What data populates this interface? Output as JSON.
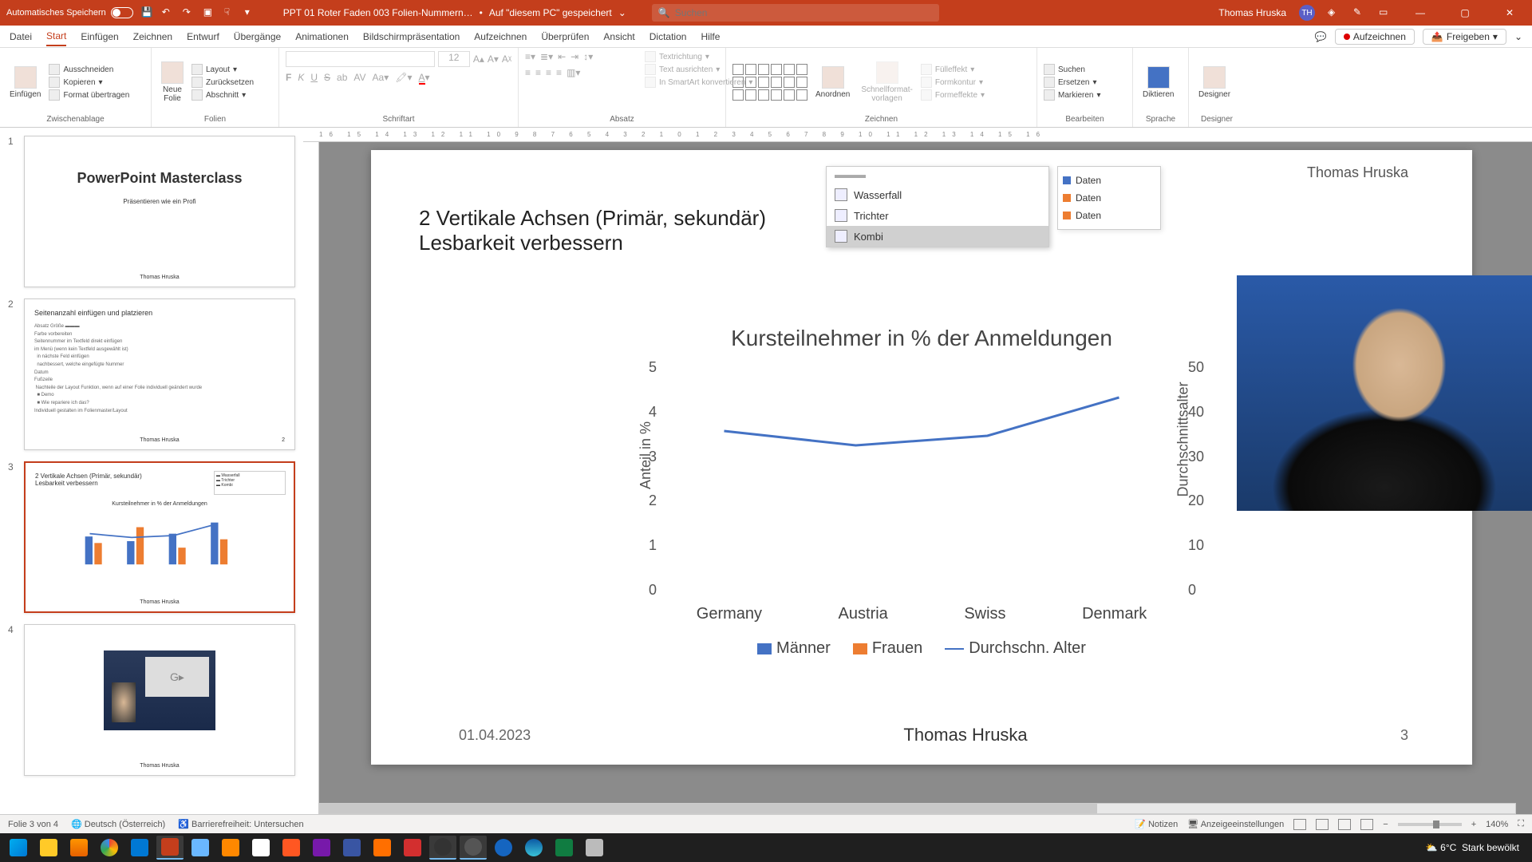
{
  "titlebar": {
    "autosave_label": "Automatisches Speichern",
    "doc_name": "PPT 01 Roter Faden 003 Folien-Nummern…",
    "saved_location": "Auf \"diesem PC\" gespeichert",
    "search_placeholder": "Suchen",
    "user_name": "Thomas Hruska",
    "user_initials": "TH"
  },
  "tabs": {
    "items": [
      "Datei",
      "Start",
      "Einfügen",
      "Zeichnen",
      "Entwurf",
      "Übergänge",
      "Animationen",
      "Bildschirmpräsentation",
      "Aufzeichnen",
      "Überprüfen",
      "Ansicht",
      "Dictation",
      "Hilfe"
    ],
    "active": "Start",
    "record_label": "Aufzeichnen",
    "share_label": "Freigeben"
  },
  "ribbon": {
    "clipboard": {
      "label": "Zwischenablage",
      "paste": "Einfügen",
      "cut": "Ausschneiden",
      "copy": "Kopieren",
      "format_painter": "Format übertragen"
    },
    "slides": {
      "label": "Folien",
      "new_slide": "Neue\nFolie",
      "layout": "Layout",
      "reset": "Zurücksetzen",
      "section": "Abschnitt"
    },
    "font": {
      "label": "Schriftart",
      "size": "12"
    },
    "paragraph": {
      "label": "Absatz",
      "text_direction": "Textrichtung",
      "align_text": "Text ausrichten",
      "smartart": "In SmartArt konvertieren"
    },
    "drawing": {
      "label": "Zeichnen",
      "arrange": "Anordnen",
      "quickstyles": "Schnellformat-\nvorlagen",
      "fill": "Fülleffekt",
      "outline": "Formkontur",
      "effects": "Formeffekte"
    },
    "editing": {
      "label": "Bearbeiten",
      "find": "Suchen",
      "replace": "Ersetzen",
      "select": "Markieren"
    },
    "voice": {
      "label": "Sprache",
      "dictate": "Diktieren"
    },
    "designer": {
      "label": "Designer",
      "btn": "Designer"
    }
  },
  "thumbs": {
    "t1": {
      "title": "PowerPoint Masterclass",
      "subtitle": "Präsentieren wie ein Profi",
      "author": "Thomas Hruska"
    },
    "t2": {
      "title": "Seitenanzahl einfügen und platzieren",
      "author": "Thomas Hruska"
    },
    "t3": {
      "author": "Thomas Hruska"
    },
    "t4": {
      "author": "Thomas Hruska"
    }
  },
  "slide": {
    "author_top": "Thomas Hruska",
    "title_line1": "2 Vertikale Achsen (Primär, sekundär)",
    "title_line2": "Lesbarkeit verbessern",
    "chart_types": {
      "wasserfall": "Wasserfall",
      "trichter": "Trichter",
      "kombi": "Kombi"
    },
    "legend_preview": {
      "d1": "Daten",
      "d2": "Daten",
      "d3": "Daten"
    },
    "footer_date": "01.04.2023",
    "footer_author": "Thomas Hruska",
    "footer_page": "3"
  },
  "chart_data": {
    "type": "bar",
    "title": "Kursteilnehmer in % der Anmeldungen",
    "categories": [
      "Germany",
      "Austria",
      "Swiss",
      "Denmark"
    ],
    "series": [
      {
        "name": "Männer",
        "values": [
          3.0,
          2.5,
          3.5,
          4.5
        ],
        "color": "#4472c4"
      },
      {
        "name": "Frauen",
        "values": [
          2.3,
          4.0,
          1.8,
          2.8
        ],
        "color": "#ed7d31"
      },
      {
        "name": "Durchschn. Alter",
        "values": [
          35,
          32,
          34,
          42
        ],
        "type": "line",
        "axis": "secondary",
        "color": "#4472c4"
      }
    ],
    "ylabel": "Anteil in %",
    "ylim": [
      0,
      5
    ],
    "y2label": "Durchschnittsalter",
    "y2lim": [
      0,
      50
    ]
  },
  "status": {
    "slide_count": "Folie 3 von 4",
    "language": "Deutsch (Österreich)",
    "accessibility": "Barrierefreiheit: Untersuchen",
    "notes": "Notizen",
    "display_settings": "Anzeigeeinstellungen",
    "zoom": "140%"
  },
  "taskbar": {
    "weather_temp": "6°C",
    "weather_desc": "Stark bewölkt"
  },
  "colors": {
    "blue": "#4472c4",
    "orange": "#ed7d31"
  }
}
